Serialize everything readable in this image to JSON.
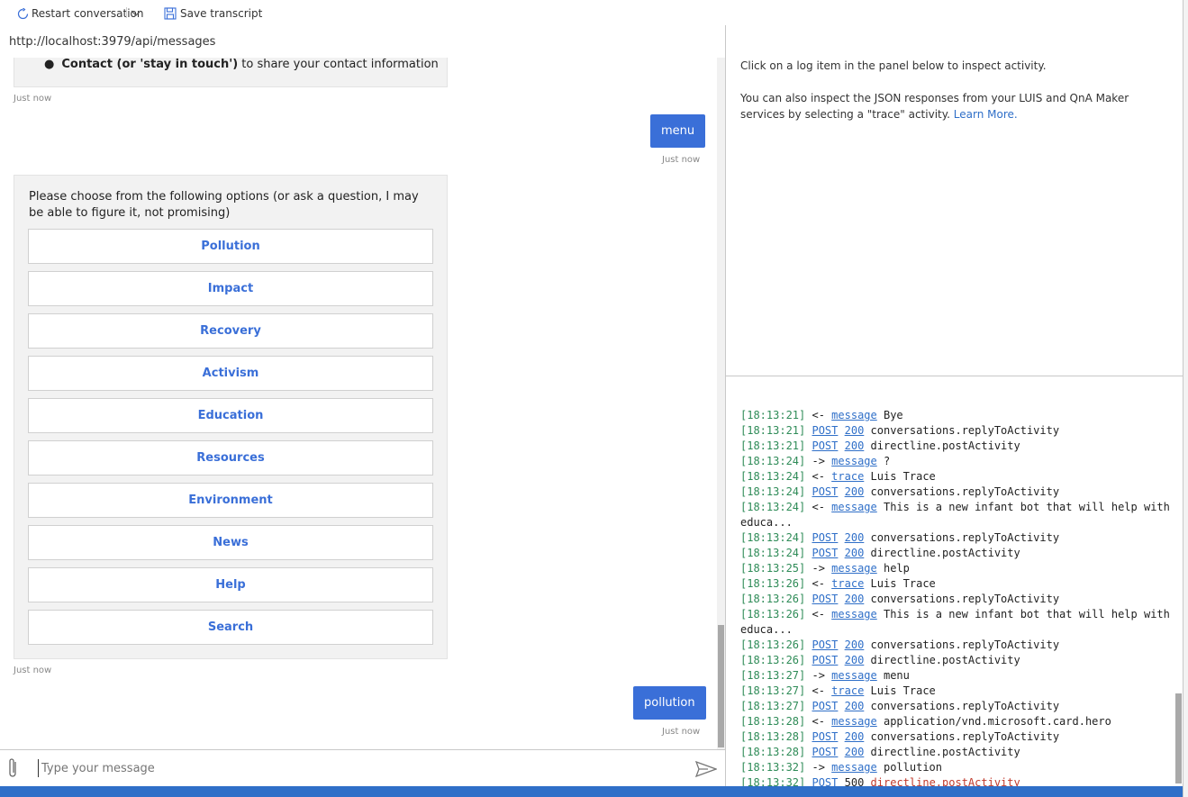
{
  "toolbar": {
    "restart_label": "Restart conversation",
    "save_label": "Save transcript"
  },
  "chat": {
    "endpoint_url": "http://localhost:3979/api/messages",
    "bullet_bold": "Contact (or 'stay in touch')",
    "bullet_rest": " to share your contact information",
    "ts1": "Just now",
    "user_msg1": "menu",
    "ts2": "Just now",
    "card_text": "Please choose from the following options (or ask a question, I may be able to figure it, not promising)",
    "options": [
      "Pollution",
      "Impact",
      "Recovery",
      "Activism",
      "Education",
      "Resources",
      "Environment",
      "News",
      "Help",
      "Search"
    ],
    "ts3": "Just now",
    "user_msg2": "pollution",
    "ts4": "Just now",
    "input_placeholder": "Type your message"
  },
  "inspector": {
    "line1": "Click on a log item in the panel below to inspect activity.",
    "line2": "You can also inspect the JSON responses from your LUIS and QnA Maker services by selecting a \"trace\" activity. ",
    "learn_more": "Learn More."
  },
  "log": [
    {
      "time": "[18:13:21]",
      "dir": "<-",
      "type": "message",
      "text": "Bye"
    },
    {
      "time": "[18:13:21]",
      "dir": "",
      "type": "POST",
      "code": "200",
      "text": "conversations.replyToActivity"
    },
    {
      "time": "[18:13:21]",
      "dir": "",
      "type": "POST",
      "code": "200",
      "text": "directline.postActivity"
    },
    {
      "time": "[18:13:24]",
      "dir": "->",
      "type": "message",
      "text": "?"
    },
    {
      "time": "[18:13:24]",
      "dir": "<-",
      "type": "trace",
      "text": "Luis Trace"
    },
    {
      "time": "[18:13:24]",
      "dir": "",
      "type": "POST",
      "code": "200",
      "text": "conversations.replyToActivity"
    },
    {
      "time": "[18:13:24]",
      "dir": "<-",
      "type": "message",
      "text": "This is a new infant bot that will help with educa..."
    },
    {
      "time": "[18:13:24]",
      "dir": "",
      "type": "POST",
      "code": "200",
      "text": "conversations.replyToActivity"
    },
    {
      "time": "[18:13:24]",
      "dir": "",
      "type": "POST",
      "code": "200",
      "text": "directline.postActivity"
    },
    {
      "time": "[18:13:25]",
      "dir": "->",
      "type": "message",
      "text": "help"
    },
    {
      "time": "[18:13:26]",
      "dir": "<-",
      "type": "trace",
      "text": "Luis Trace"
    },
    {
      "time": "[18:13:26]",
      "dir": "",
      "type": "POST",
      "code": "200",
      "text": "conversations.replyToActivity"
    },
    {
      "time": "[18:13:26]",
      "dir": "<-",
      "type": "message",
      "text": "This is a new infant bot that will help with educa..."
    },
    {
      "time": "[18:13:26]",
      "dir": "",
      "type": "POST",
      "code": "200",
      "text": "conversations.replyToActivity"
    },
    {
      "time": "[18:13:26]",
      "dir": "",
      "type": "POST",
      "code": "200",
      "text": "directline.postActivity"
    },
    {
      "time": "[18:13:27]",
      "dir": "->",
      "type": "message",
      "text": "menu"
    },
    {
      "time": "[18:13:27]",
      "dir": "<-",
      "type": "trace",
      "text": "Luis Trace"
    },
    {
      "time": "[18:13:27]",
      "dir": "",
      "type": "POST",
      "code": "200",
      "text": "conversations.replyToActivity"
    },
    {
      "time": "[18:13:28]",
      "dir": "<-",
      "type": "message",
      "text": "application/vnd.microsoft.card.hero"
    },
    {
      "time": "[18:13:28]",
      "dir": "",
      "type": "POST",
      "code": "200",
      "text": "conversations.replyToActivity"
    },
    {
      "time": "[18:13:28]",
      "dir": "",
      "type": "POST",
      "code": "200",
      "text": "directline.postActivity"
    },
    {
      "time": "[18:13:32]",
      "dir": "->",
      "type": "message",
      "text": "pollution"
    },
    {
      "time": "[18:13:32]",
      "dir": "",
      "type": "POST",
      "code": "500",
      "text": "directline.postActivity",
      "error": true
    }
  ],
  "colors": {
    "accent": "#3a6fd8",
    "status_bar": "#2f6fc8",
    "log_time": "#2e8b57",
    "log_error": "#c0392b"
  }
}
